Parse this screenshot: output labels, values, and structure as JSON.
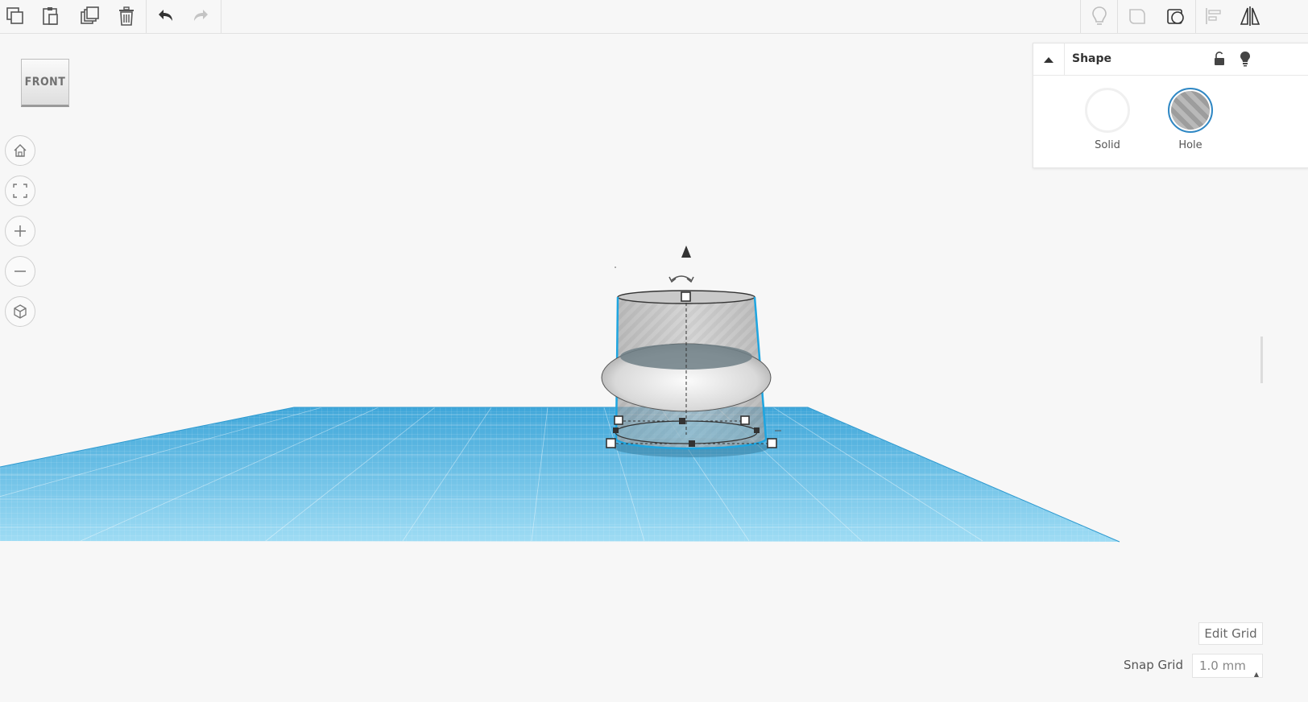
{
  "toolbar": {
    "left": [
      "copy-icon",
      "paste-icon",
      "duplicate-icon",
      "delete-icon",
      "undo-icon",
      "redo-icon"
    ],
    "right": [
      "light-bulb-icon",
      "shape-outline-icon",
      "group-icon",
      "align-icon",
      "mirror-icon"
    ]
  },
  "viewcube": {
    "face_label": "FRONT"
  },
  "nav": [
    "home-view-icon",
    "fit-view-icon",
    "zoom-in-icon",
    "zoom-out-icon",
    "ortho-view-icon"
  ],
  "shape_panel": {
    "title": "Shape",
    "options": [
      {
        "label": "Solid",
        "selected": false
      },
      {
        "label": "Hole",
        "selected": true
      }
    ]
  },
  "grid_controls": {
    "edit_grid_label": "Edit Grid",
    "snap_grid_label": "Snap Grid",
    "snap_grid_value": "1.0 mm"
  },
  "colors": {
    "workplane": "#5bbde8",
    "selection": "#1ea5e0",
    "hole_fill": "#b9b9b9",
    "accent": "#2f88c5"
  }
}
